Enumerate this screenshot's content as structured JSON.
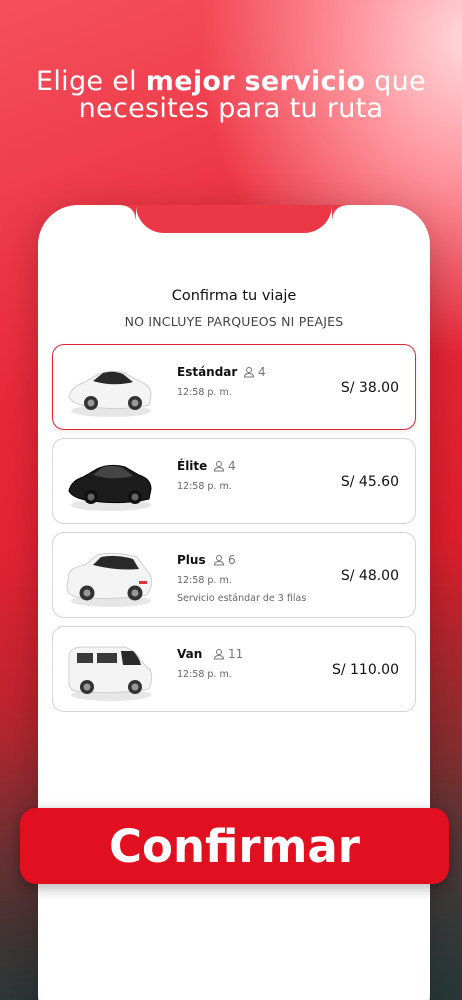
{
  "headline": {
    "prefix": "Elige el ",
    "bold": "mejor servicio",
    "suffix": " que",
    "line2": "necesites para tu ruta"
  },
  "sheet": {
    "title": "Confirma tu viaje",
    "subtitle": "NO INCLUYE PARQUEOS NI PEAJES"
  },
  "options": [
    {
      "name": "Estándar",
      "seats": "4",
      "time": "12:58 p. m.",
      "desc": "",
      "price": "S/ 38.00",
      "selected": true,
      "icon": "sedan-white-icon"
    },
    {
      "name": "Élite",
      "seats": "4",
      "time": "12:58 p. m.",
      "desc": "",
      "price": "S/ 45.60",
      "selected": false,
      "icon": "sedan-black-icon"
    },
    {
      "name": "Plus",
      "seats": "6",
      "time": "12:58 p. m.",
      "desc": "Servicio estándar de 3 filas",
      "price": "S/ 48.00",
      "selected": false,
      "icon": "suv-white-icon"
    },
    {
      "name": "Van",
      "seats": "11",
      "time": "12:58 p. m.",
      "desc": "",
      "price": "S/ 110.00",
      "selected": false,
      "icon": "van-white-icon"
    }
  ],
  "confirm_label": "Confirmar",
  "colors": {
    "accent": "#e10f1f",
    "selected_border": "#e0283a"
  }
}
